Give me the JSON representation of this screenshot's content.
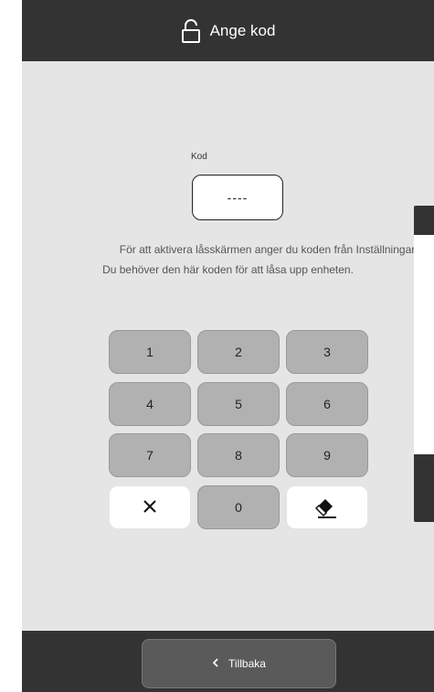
{
  "header": {
    "title": "Ange kod",
    "icon": "unlock-icon"
  },
  "code": {
    "label": "Kod",
    "value": "----"
  },
  "info": {
    "line1": "För att aktivera låsskärmen anger du koden från Inställningar",
    "line2": "Du behöver den här koden för att låsa upp enheten."
  },
  "keypad": {
    "k1": "1",
    "k2": "2",
    "k3": "3",
    "k4": "4",
    "k5": "5",
    "k6": "6",
    "k7": "7",
    "k8": "8",
    "k9": "9",
    "k0": "0",
    "clear_icon": "close-icon",
    "erase_icon": "eraser-icon"
  },
  "footer": {
    "back_label": "Tillbaka",
    "back_icon": "chevron-left-icon"
  },
  "colors": {
    "background": "#e5e5e5",
    "bar": "#333333",
    "key": "#b1b1b1",
    "key_white": "#ffffff"
  }
}
